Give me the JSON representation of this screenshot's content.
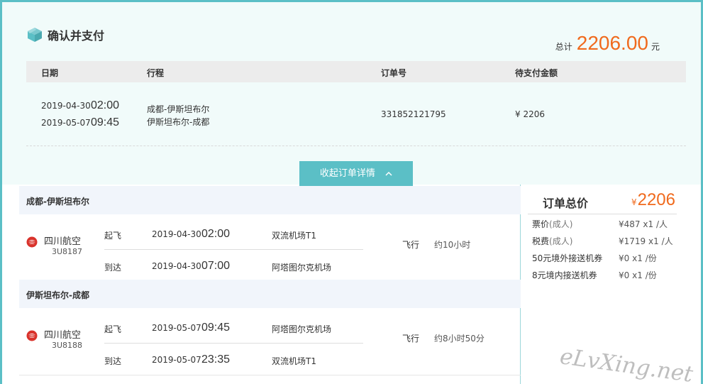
{
  "header": {
    "title": "确认并支付",
    "total_label": "总计",
    "total_amount": "2206.00",
    "total_unit": "元"
  },
  "order_table": {
    "columns": [
      "日期",
      "行程",
      "订单号",
      "待支付金额"
    ],
    "row": {
      "dates": [
        {
          "date": "2019-04-30",
          "time": "02:00"
        },
        {
          "date": "2019-05-07",
          "time": "09:45"
        }
      ],
      "routes": [
        "成都-伊斯坦布尔",
        "伊斯坦布尔-成都"
      ],
      "order_no": "331852121795",
      "amount": "¥ 2206"
    }
  },
  "collapse_button": {
    "label": "收起订单详情"
  },
  "segments": [
    {
      "route": "成都-伊斯坦布尔",
      "airline": "四川航空",
      "flight_no": "3U8187",
      "depart": {
        "label": "起飞",
        "date": "2019-04-30",
        "time": "02:00",
        "airport": "双流机场T1"
      },
      "arrive": {
        "label": "到达",
        "date": "2019-04-30",
        "time": "07:00",
        "airport": "阿塔图尔克机场"
      },
      "fly_label": "飞行",
      "duration": "约10小时"
    },
    {
      "route": "伊斯坦布尔-成都",
      "airline": "四川航空",
      "flight_no": "3U8188",
      "depart": {
        "label": "起飞",
        "date": "2019-05-07",
        "time": "09:45",
        "airport": "阿塔图尔克机场"
      },
      "arrive": {
        "label": "到达",
        "date": "2019-05-07",
        "time": "23:35",
        "airport": "双流机场T1"
      },
      "fly_label": "飞行",
      "duration": "约8小时50分"
    }
  ],
  "summary": {
    "title": "订单总价",
    "currency": "¥",
    "total": "2206",
    "fees": [
      {
        "label": "票价",
        "sub": "(成人)",
        "price": "¥487",
        "qty": "x1",
        "unit": "/人"
      },
      {
        "label": "税费",
        "sub": "(成人)",
        "price": "¥1719",
        "qty": "x1",
        "unit": "/人"
      },
      {
        "label": "50元境外接送机券",
        "sub": "",
        "price": "¥0",
        "qty": "x1",
        "unit": "/份"
      },
      {
        "label": "8元境内接送机券",
        "sub": "",
        "price": "¥0",
        "qty": "x1",
        "unit": "/份"
      }
    ]
  },
  "watermark": "eLvXing.net",
  "colors": {
    "accent": "#5bbfc6",
    "price": "#f06a1d",
    "airline_logo": "#d9322b"
  },
  "icons": {
    "title": "box-icon",
    "airline": "sichuan-airlines-logo-icon",
    "collapse": "chevron-up-icon"
  }
}
